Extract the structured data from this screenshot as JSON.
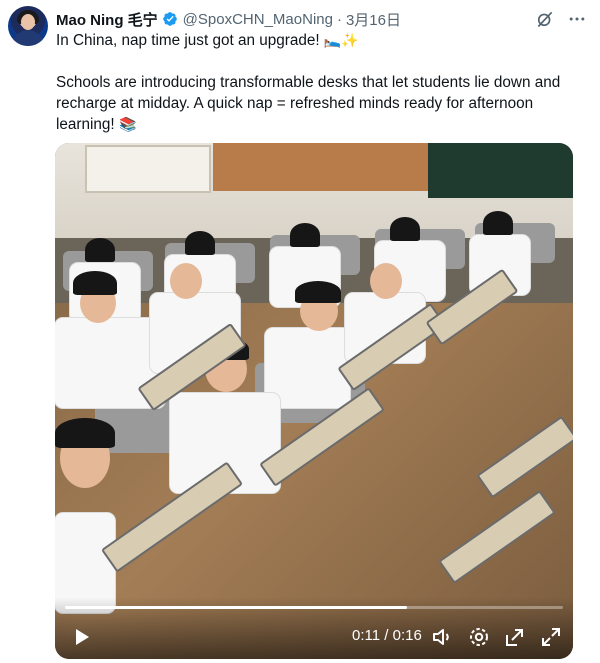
{
  "tweet": {
    "author_name": "Mao Ning 毛宁",
    "handle": "@SpoxCHN_MaoNing",
    "separator": "·",
    "date": "3月16日",
    "line1": "In China, nap time just got an upgrade!",
    "line1_emoji": "🛌✨",
    "line2": "Schools are introducing transformable desks that let students lie down and recharge at midday. A quick nap = refreshed minds ready for afternoon learning!",
    "line2_emoji": "📚"
  },
  "video": {
    "time_current": "0:11",
    "time_separator": " / ",
    "time_total": "0:16",
    "progress_fraction": 0.6875
  },
  "icons": {
    "verified": "verified-badge-icon",
    "grok": "grok-icon",
    "more": "more-icon",
    "play": "play-icon",
    "volume": "volume-icon",
    "settings": "settings-icon",
    "popout": "popout-icon",
    "fullscreen": "fullscreen-icon"
  },
  "colors": {
    "verified": "#1d9bf0",
    "secondary_text": "#536471"
  }
}
